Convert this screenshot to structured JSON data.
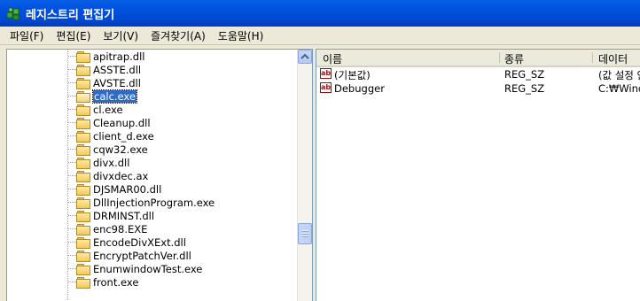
{
  "window": {
    "title": "레지스트리 편집기"
  },
  "menu": [
    "파일(F)",
    "편집(E)",
    "보기(V)",
    "즐겨찾기(A)",
    "도움말(H)"
  ],
  "tree": {
    "items": [
      {
        "label": "apitrap.dll"
      },
      {
        "label": "ASSTE.dll"
      },
      {
        "label": "AVSTE.dll"
      },
      {
        "label": "calc.exe",
        "selected": true
      },
      {
        "label": "cl.exe"
      },
      {
        "label": "Cleanup.dll"
      },
      {
        "label": "client_d.exe"
      },
      {
        "label": "cqw32.exe"
      },
      {
        "label": "divx.dll"
      },
      {
        "label": "divxdec.ax"
      },
      {
        "label": "DJSMAR00.dll"
      },
      {
        "label": "DllInjectionProgram.exe"
      },
      {
        "label": "DRMINST.dll"
      },
      {
        "label": "enc98.EXE"
      },
      {
        "label": "EncodeDivXExt.dll"
      },
      {
        "label": "EncryptPatchVer.dll"
      },
      {
        "label": "EnumwindowTest.exe"
      },
      {
        "label": "front.exe"
      }
    ]
  },
  "list": {
    "columns": [
      "이름",
      "종류",
      "데이터"
    ],
    "rows": [
      {
        "name": "(기본값)",
        "type": "REG_SZ",
        "data": "(값 설정 안 됨)"
      },
      {
        "name": "Debugger",
        "type": "REG_SZ",
        "data": "C:₩Windows"
      }
    ]
  },
  "colors": {
    "titlebar": "#0054e3",
    "selection": "#316ac5",
    "chrome": "#ece9d8"
  }
}
